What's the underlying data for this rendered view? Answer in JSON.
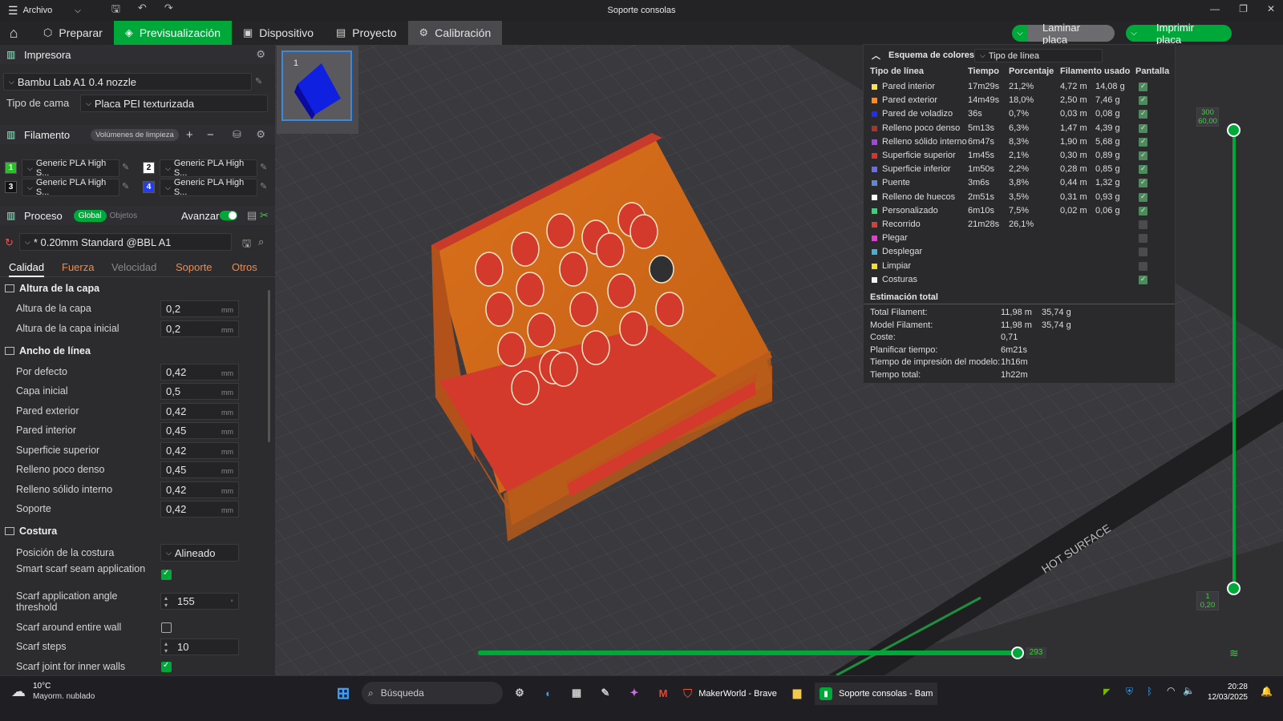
{
  "titlebar": {
    "menu_label": "Archivo",
    "window_title": "Soporte consolas"
  },
  "toolbar": {
    "tabs": [
      {
        "label": "Preparar"
      },
      {
        "label": "Previsualización"
      },
      {
        "label": "Dispositivo"
      },
      {
        "label": "Proyecto"
      },
      {
        "label": "Calibración"
      }
    ],
    "slice_button": "Laminar placa",
    "print_button": "Imprimir placa"
  },
  "printer": {
    "section_title": "Impresora",
    "printer_name": "Bambu Lab A1 0.4 nozzle",
    "bed_label": "Tipo de cama",
    "bed_value": "Placa PEI texturizada"
  },
  "filament": {
    "section_title": "Filamento",
    "purge_button": "Volúmenes de limpieza",
    "slots": [
      {
        "num": "1",
        "name": "Generic PLA High S...",
        "color": "#22c322"
      },
      {
        "num": "2",
        "name": "Generic PLA High S...",
        "color": "#ffffff"
      },
      {
        "num": "3",
        "name": "Generic PLA High S...",
        "color": "#111111"
      },
      {
        "num": "4",
        "name": "Generic PLA High S...",
        "color": "#1f3cff"
      }
    ]
  },
  "process": {
    "section_title": "Proceso",
    "global_label": "Global",
    "objects_label": "Objetos",
    "advanced_label": "Avanzar",
    "preset": "* 0.20mm Standard @BBL A1",
    "tabs": [
      "Calidad",
      "Fuerza",
      "Velocidad",
      "Soporte",
      "Otros"
    ],
    "groups": {
      "layer_height": {
        "title": "Altura de la capa",
        "rows": [
          {
            "label": "Altura de la capa",
            "value": "0,2",
            "unit": "mm"
          },
          {
            "label": "Altura de la capa inicial",
            "value": "0,2",
            "unit": "mm"
          }
        ]
      },
      "line_width": {
        "title": "Ancho de línea",
        "rows": [
          {
            "label": "Por defecto",
            "value": "0,42",
            "unit": "mm"
          },
          {
            "label": "Capa inicial",
            "value": "0,5",
            "unit": "mm"
          },
          {
            "label": "Pared exterior",
            "value": "0,42",
            "unit": "mm"
          },
          {
            "label": "Pared interior",
            "value": "0,45",
            "unit": "mm"
          },
          {
            "label": "Superficie superior",
            "value": "0,42",
            "unit": "mm"
          },
          {
            "label": "Relleno poco denso",
            "value": "0,45",
            "unit": "mm"
          },
          {
            "label": "Relleno sólido interno",
            "value": "0,42",
            "unit": "mm"
          },
          {
            "label": "Soporte",
            "value": "0,42",
            "unit": "mm"
          }
        ]
      },
      "seam": {
        "title": "Costura",
        "position_label": "Posición de la costura",
        "position_value": "Alineado",
        "smart_scarf_label": "Smart scarf seam application",
        "angle_label": "Scarf application angle threshold",
        "angle_value": "155",
        "angle_unit": "°",
        "entire_wall_label": "Scarf around entire wall",
        "steps_label": "Scarf steps",
        "steps_value": "10",
        "inner_walls_label": "Scarf joint for inner walls"
      }
    }
  },
  "plate": {
    "number": "1"
  },
  "legend": {
    "title": "Esquema de colores",
    "scheme_value": "Tipo de línea",
    "headers": [
      "Tipo de línea",
      "Tiempo",
      "Porcentaje",
      "Filamento usado",
      "Pantalla"
    ],
    "rows": [
      {
        "name": "Pared interior",
        "time": "17m29s",
        "pct": "21,2%",
        "len": "4,72 m",
        "weight": "14,08 g",
        "color": "#ffe23a",
        "shown": true
      },
      {
        "name": "Pared exterior",
        "time": "14m49s",
        "pct": "18,0%",
        "len": "2,50 m",
        "weight": "7,46 g",
        "color": "#ff8a1e",
        "shown": true
      },
      {
        "name": "Pared de voladizo",
        "time": "36s",
        "pct": "0,7%",
        "len": "0,03 m",
        "weight": "0,08 g",
        "color": "#1f2bff",
        "shown": true
      },
      {
        "name": "Relleno poco denso",
        "time": "5m13s",
        "pct": "6,3%",
        "len": "1,47 m",
        "weight": "4,39 g",
        "color": "#b0302a",
        "shown": true
      },
      {
        "name": "Relleno sólido interno",
        "time": "6m47s",
        "pct": "8,3%",
        "len": "1,90 m",
        "weight": "5,68 g",
        "color": "#a048d8",
        "shown": true
      },
      {
        "name": "Superficie superior",
        "time": "1m45s",
        "pct": "2,1%",
        "len": "0,30 m",
        "weight": "0,89 g",
        "color": "#e0302e",
        "shown": true
      },
      {
        "name": "Superficie inferior",
        "time": "1m50s",
        "pct": "2,2%",
        "len": "0,28 m",
        "weight": "0,85 g",
        "color": "#6c6ce0",
        "shown": true
      },
      {
        "name": "Puente",
        "time": "3m6s",
        "pct": "3,8%",
        "len": "0,44 m",
        "weight": "1,32 g",
        "color": "#5a8ad8",
        "shown": true
      },
      {
        "name": "Relleno de huecos",
        "time": "2m51s",
        "pct": "3,5%",
        "len": "0,31 m",
        "weight": "0,93 g",
        "color": "#ffffff",
        "shown": true
      },
      {
        "name": "Personalizado",
        "time": "6m10s",
        "pct": "7,5%",
        "len": "0,02 m",
        "weight": "0,06 g",
        "color": "#3cd07a",
        "shown": true
      },
      {
        "name": "Recorrido",
        "time": "21m28s",
        "pct": "26,1%",
        "len": "",
        "weight": "",
        "color": "#e03b3b",
        "shown": false
      },
      {
        "name": "Plegar",
        "time": "",
        "pct": "",
        "len": "",
        "weight": "",
        "color": "#e040d0",
        "shown": false
      },
      {
        "name": "Desplegar",
        "time": "",
        "pct": "",
        "len": "",
        "weight": "",
        "color": "#44b0d8",
        "shown": false
      },
      {
        "name": "Limpiar",
        "time": "",
        "pct": "",
        "len": "",
        "weight": "",
        "color": "#f0e020",
        "shown": false
      },
      {
        "name": "Costuras",
        "time": "",
        "pct": "",
        "len": "",
        "weight": "",
        "color": "#f2f2f2",
        "shown": true
      }
    ],
    "estimate_title": "Estimación total",
    "estimates": [
      {
        "label": "Total Filament:",
        "v1": "11,98 m",
        "v2": "35,74 g"
      },
      {
        "label": "Model Filament:",
        "v1": "11,98 m",
        "v2": "35,74 g"
      },
      {
        "label": "Coste:",
        "v1": "0,71",
        "v2": ""
      },
      {
        "label": "Planificar tiempo:",
        "v1": "6m21s",
        "v2": ""
      },
      {
        "label": "Tiempo de impresión del modelo:",
        "v1": "1h16m",
        "v2": ""
      },
      {
        "label": "Tiempo total:",
        "v1": "1h22m",
        "v2": ""
      }
    ]
  },
  "layer_slider": {
    "top_layer": "300",
    "top_height": "60,00",
    "bottom_layer": "1",
    "bottom_height": "0,20"
  },
  "move_slider": {
    "value": "293"
  },
  "bed": {
    "hot_text": "HOT SURFACE"
  },
  "taskbar": {
    "temp": "10°C",
    "weather": "Mayorm. nublado",
    "search_placeholder": "Búsqueda",
    "apps": [
      {
        "label": "MakerWorld - Brave"
      },
      {
        "label": "Soporte consolas - Bam"
      }
    ],
    "time": "20:28",
    "date": "12/03/2025"
  }
}
